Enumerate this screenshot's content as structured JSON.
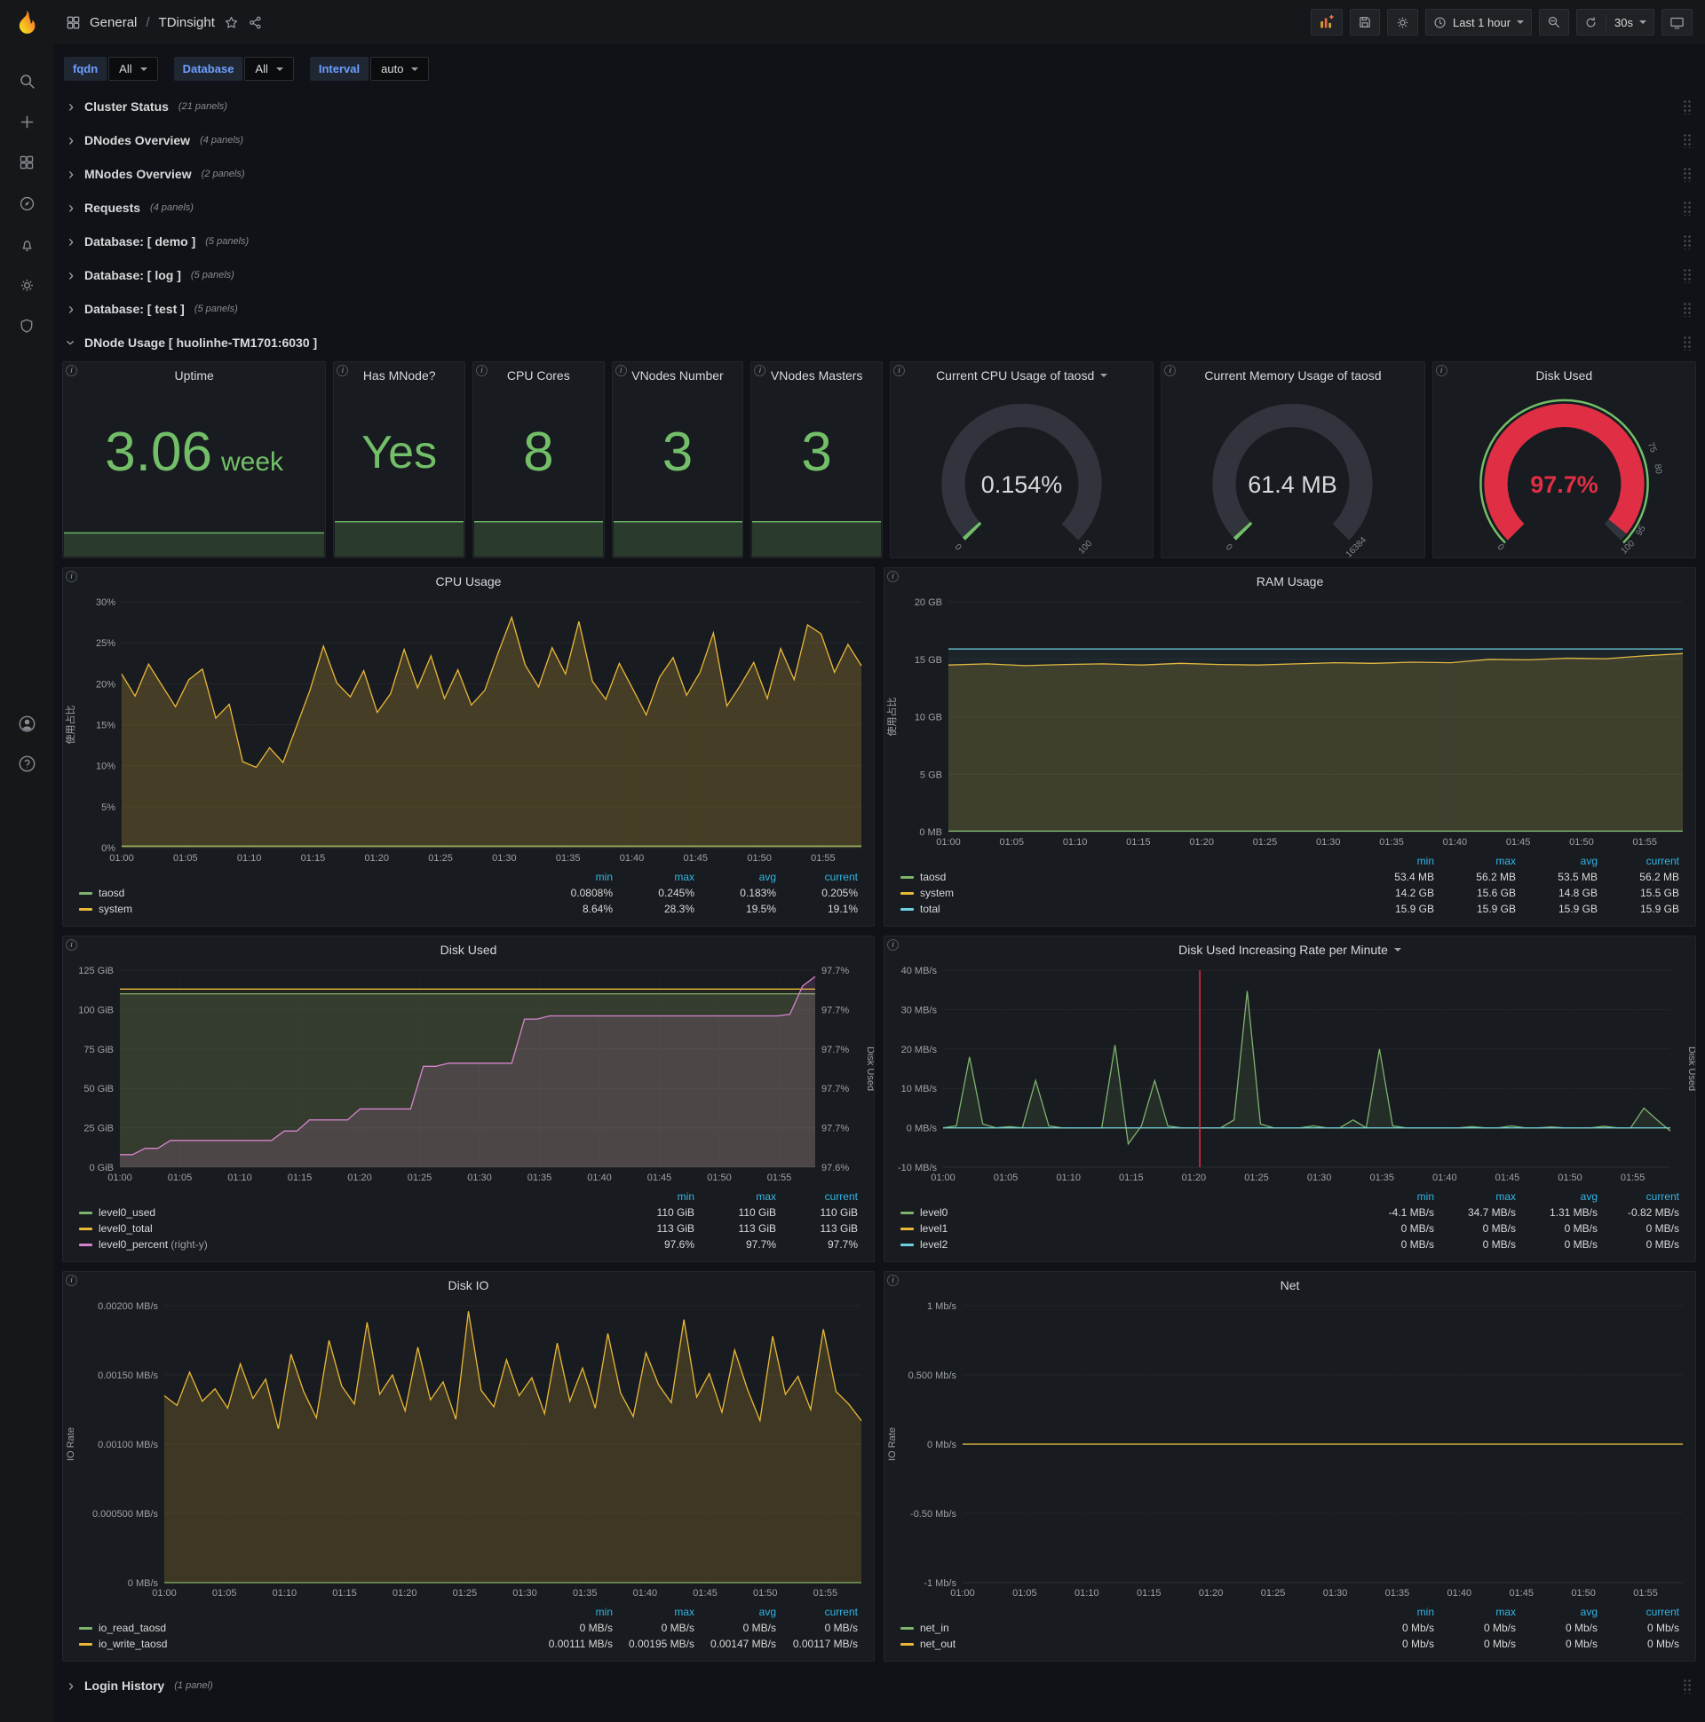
{
  "icons": {
    "info": "i",
    "chevron": "›",
    "star": "☆"
  },
  "nav": {
    "section": "General",
    "separator": "/",
    "page": "TDinsight",
    "time_range": "Last 1 hour",
    "refresh": "30s"
  },
  "variables": {
    "fqdn": {
      "label": "fqdn",
      "value": "All"
    },
    "database": {
      "label": "Database",
      "value": "All"
    },
    "interval": {
      "label": "Interval",
      "value": "auto"
    }
  },
  "rows": [
    {
      "title": "Cluster Status",
      "count": "(21 panels)"
    },
    {
      "title": "DNodes Overview",
      "count": "(4 panels)"
    },
    {
      "title": "MNodes Overview",
      "count": "(2 panels)"
    },
    {
      "title": "Requests",
      "count": "(4 panels)"
    },
    {
      "title": "Database: [ demo ]",
      "count": "(5 panels)"
    },
    {
      "title": "Database: [ log ]",
      "count": "(5 panels)"
    },
    {
      "title": "Database: [ test ]",
      "count": "(5 panels)"
    }
  ],
  "dnode_row": {
    "title": "DNode Usage [ huolinhe-TM1701:6030 ]"
  },
  "login_row": {
    "title": "Login History",
    "count": "(1 panel)"
  },
  "stats": {
    "uptime": {
      "title": "Uptime",
      "value": "3.06",
      "unit": "week"
    },
    "has_mnode": {
      "title": "Has MNode?",
      "value": "Yes"
    },
    "cpu_cores": {
      "title": "CPU Cores",
      "value": "8"
    },
    "vnodes_number": {
      "title": "VNodes Number",
      "value": "3"
    },
    "vnodes_masters": {
      "title": "VNodes Masters",
      "value": "3"
    }
  },
  "gauges": {
    "cpu": {
      "title": "Current CPU Usage of taosd",
      "value_text": "0.154%",
      "value_color": "#d8d9da",
      "color": "#73BF69",
      "fraction": 0.00154,
      "min_label": "0",
      "max_label": "100"
    },
    "mem": {
      "title": "Current Memory Usage of taosd",
      "value_text": "61.4 MB",
      "value_color": "#d8d9da",
      "color": "#73BF69",
      "fraction": 0.0037,
      "min_label": "0",
      "max_label": "16384"
    },
    "disk": {
      "title": "Disk Used",
      "value_text": "97.7%",
      "value_color": "#E02F44",
      "color": "#E02F44",
      "fraction": 0.977,
      "min_label": "0",
      "ring": "#73BF69",
      "ticks": [
        {
          "f": 0.75,
          "label": "75"
        },
        {
          "f": 0.8,
          "label": "80"
        },
        {
          "f": 0.95,
          "label": "95"
        },
        {
          "f": 1,
          "label": "100"
        }
      ]
    }
  },
  "shared": {
    "x_labels": [
      "01:00",
      "01:05",
      "01:10",
      "01:15",
      "01:20",
      "01:25",
      "01:30",
      "01:35",
      "01:40",
      "01:45",
      "01:50",
      "01:55"
    ]
  },
  "charts": {
    "cpu_usage": {
      "type": "line",
      "title": "CPU Usage",
      "y_label": "使用占比",
      "pad_l": 52,
      "y_min": 0,
      "y_max": 30,
      "y_ticks": [
        "0%",
        "5%",
        "10%",
        "15%",
        "20%",
        "25%",
        "30%"
      ],
      "series": [
        {
          "name": "taosd",
          "color": "#7EB26D",
          "fill": 0.1,
          "values": [
            0.2,
            0.2
          ]
        },
        {
          "name": "system",
          "color": "#EAB839",
          "fill": 0.22,
          "values": [
            21.2,
            18.5,
            22.4,
            19.8,
            17.2,
            20.5,
            21.8,
            15.8,
            17.5,
            10.5,
            9.8,
            12.2,
            10.4,
            14.8,
            19.2,
            24.6,
            20.1,
            18.4,
            21.6,
            16.5,
            18.8,
            24.2,
            19.5,
            23.4,
            18.2,
            21.7,
            17.4,
            19.2,
            23.8,
            28.1,
            22.3,
            19.6,
            24.4,
            21.2,
            27.6,
            20.3,
            18.1,
            22.5,
            19.4,
            16.2,
            20.8,
            23.2,
            18.6,
            21.4,
            26.2,
            17.3,
            19.8,
            22.6,
            18.2,
            24.3,
            20.5,
            27.2,
            26.1,
            21.4,
            24.8,
            22.2
          ]
        }
      ],
      "legend": {
        "columns": [
          "min",
          "max",
          "avg",
          "current"
        ],
        "rows": [
          {
            "name": "taosd",
            "color": "#7EB26D",
            "values": [
              "0.0808%",
              "0.245%",
              "0.183%",
              "0.205%"
            ]
          },
          {
            "name": "system",
            "color": "#EAB839",
            "values": [
              "8.64%",
              "28.3%",
              "19.5%",
              "19.1%"
            ]
          }
        ]
      }
    },
    "ram_usage": {
      "type": "line",
      "title": "RAM Usage",
      "y_label": "使用占比",
      "pad_l": 58,
      "y_min": 0,
      "y_max": 20,
      "y_ticks": [
        "0 MB",
        "5 GB",
        "10 GB",
        "15 GB",
        "20 GB"
      ],
      "series": [
        {
          "name": "system",
          "color": "#EAB839",
          "fill": 0.18,
          "values": [
            14.5,
            14.6,
            14.45,
            14.55,
            14.6,
            14.5,
            14.65,
            14.55,
            14.5,
            14.6,
            14.7,
            14.65,
            14.75,
            14.7,
            15.0,
            14.95,
            15.1,
            15.05,
            15.3,
            15.5
          ]
        },
        {
          "name": "total",
          "color": "#6ED0E0",
          "fill": 0.06,
          "values": [
            15.9,
            15.9
          ]
        },
        {
          "name": "taosd",
          "color": "#7EB26D",
          "fill": 0.1,
          "values": [
            0.055,
            0.055
          ]
        }
      ],
      "legend": {
        "columns": [
          "min",
          "max",
          "avg",
          "current"
        ],
        "rows": [
          {
            "name": "taosd",
            "color": "#7EB26D",
            "values": [
              "53.4 MB",
              "56.2 MB",
              "53.5 MB",
              "56.2 MB"
            ]
          },
          {
            "name": "system",
            "color": "#EAB839",
            "values": [
              "14.2 GB",
              "15.6 GB",
              "14.8 GB",
              "15.5 GB"
            ]
          },
          {
            "name": "total",
            "color": "#6ED0E0",
            "values": [
              "15.9 GB",
              "15.9 GB",
              "15.9 GB",
              "15.9 GB"
            ]
          }
        ]
      }
    },
    "disk_used": {
      "type": "line",
      "title": "Disk Used",
      "pad_l": 64,
      "pad_r": 52,
      "y2_label": "Disk Used",
      "y_min": 0,
      "y_max": 125,
      "y_ticks": [
        "0 GiB",
        "25 GiB",
        "50 GiB",
        "75 GiB",
        "100 GiB",
        "125 GiB"
      ],
      "y2_min": 97.595,
      "y2_max": 97.72,
      "y2_ticks": [
        "97.6%",
        "97.7%",
        "97.7%",
        "97.7%",
        "97.7%",
        "97.7%"
      ],
      "series": [
        {
          "name": "level0_used",
          "color": "#7EB26D",
          "fill": 0.18,
          "values": [
            110,
            110
          ]
        },
        {
          "name": "level0_total",
          "color": "#EAB839",
          "fill": 0.05,
          "values": [
            113,
            113
          ]
        },
        {
          "name": "level0_percent",
          "color": "#D683CE",
          "fill": 0.16,
          "axis": "y2",
          "values": [
            97.603,
            97.603,
            97.607,
            97.607,
            97.612,
            97.612,
            97.612,
            97.612,
            97.612,
            97.612,
            97.612,
            97.612,
            97.612,
            97.618,
            97.618,
            97.625,
            97.625,
            97.625,
            97.625,
            97.632,
            97.632,
            97.632,
            97.632,
            97.632,
            97.659,
            97.659,
            97.661,
            97.661,
            97.661,
            97.661,
            97.661,
            97.661,
            97.689,
            97.689,
            97.691,
            97.691,
            97.691,
            97.691,
            97.691,
            97.691,
            97.691,
            97.691,
            97.691,
            97.691,
            97.691,
            97.691,
            97.691,
            97.691,
            97.691,
            97.691,
            97.691,
            97.691,
            97.691,
            97.692,
            97.71,
            97.716
          ]
        }
      ],
      "legend": {
        "columns": [
          "min",
          "max",
          "current"
        ],
        "rows": [
          {
            "name": "level0_used",
            "color": "#7EB26D",
            "values": [
              "110 GiB",
              "110 GiB",
              "110 GiB"
            ]
          },
          {
            "name": "level0_total",
            "color": "#EAB839",
            "values": [
              "113 GiB",
              "113 GiB",
              "113 GiB"
            ]
          },
          {
            "name": "level0_percent",
            "color": "#D683CE",
            "suffix": "(right-y)",
            "values": [
              "97.6%",
              "97.7%",
              "97.7%"
            ]
          }
        ]
      }
    },
    "disk_rate": {
      "type": "line",
      "title": "Disk Used Increasing Rate per Minute",
      "pad_l": 66,
      "y2_label": "Disk Used",
      "annotation_x": 0.353,
      "y_min": -10,
      "y_max": 40,
      "y_ticks": [
        "-10 MB/s",
        "0 MB/s",
        "10 MB/s",
        "20 MB/s",
        "30 MB/s",
        "40 MB/s"
      ],
      "series": [
        {
          "name": "level0",
          "color": "#7EB26D",
          "fill": 0.12,
          "values": [
            0,
            0.5,
            18,
            1,
            0,
            0.3,
            0,
            12,
            0.5,
            0,
            0,
            0,
            0,
            21,
            -4.1,
            0.5,
            12,
            0.5,
            0,
            0,
            0,
            0,
            2,
            34.7,
            1,
            0,
            0,
            0,
            0.5,
            0,
            0,
            2,
            0,
            20,
            0.5,
            0,
            0,
            0,
            0,
            0,
            0.3,
            0,
            0,
            0.5,
            0,
            0,
            0.2,
            0,
            0,
            0,
            0.4,
            0,
            0,
            5,
            2,
            -0.82
          ]
        },
        {
          "name": "level1",
          "color": "#EAB839",
          "values": [
            0,
            0
          ]
        },
        {
          "name": "level2",
          "color": "#6ED0E0",
          "values": [
            0,
            0
          ]
        }
      ],
      "legend": {
        "columns": [
          "min",
          "max",
          "avg",
          "current"
        ],
        "rows": [
          {
            "name": "level0",
            "color": "#7EB26D",
            "values": [
              "-4.1 MB/s",
              "34.7 MB/s",
              "1.31 MB/s",
              "-0.82 MB/s"
            ]
          },
          {
            "name": "level1",
            "color": "#EAB839",
            "values": [
              "0 MB/s",
              "0 MB/s",
              "0 MB/s",
              "0 MB/s"
            ]
          },
          {
            "name": "level2",
            "color": "#6ED0E0",
            "values": [
              "0 MB/s",
              "0 MB/s",
              "0 MB/s",
              "0 MB/s"
            ]
          }
        ]
      }
    },
    "disk_io": {
      "type": "line",
      "title": "Disk IO",
      "y_label": "IO Rate",
      "pad_l": 100,
      "y_min": 0,
      "y_max": 0.002,
      "y_ticks": [
        "0 MB/s",
        "0.000500 MB/s",
        "0.00100 MB/s",
        "0.00150 MB/s",
        "0.00200 MB/s"
      ],
      "series": [
        {
          "name": "io_read_taosd",
          "color": "#7EB26D",
          "values": [
            0,
            0
          ]
        },
        {
          "name": "io_write_taosd",
          "color": "#EAB839",
          "fill": 0.18,
          "values": [
            0.00135,
            0.00128,
            0.00152,
            0.00131,
            0.0014,
            0.00126,
            0.00158,
            0.00133,
            0.00147,
            0.00111,
            0.00165,
            0.00138,
            0.00119,
            0.00175,
            0.00142,
            0.00129,
            0.00188,
            0.00136,
            0.0015,
            0.00124,
            0.0017,
            0.00132,
            0.00145,
            0.00118,
            0.00196,
            0.00139,
            0.00127,
            0.00161,
            0.00135,
            0.00148,
            0.00122,
            0.00173,
            0.00131,
            0.00155,
            0.00126,
            0.0018,
            0.00137,
            0.0012,
            0.00166,
            0.00143,
            0.0013,
            0.0019,
            0.00134,
            0.00151,
            0.00123,
            0.00168,
            0.0014,
            0.00117,
            0.00178,
            0.00136,
            0.00149,
            0.00125,
            0.00183,
            0.00138,
            0.00129,
            0.00117
          ]
        }
      ],
      "legend": {
        "columns": [
          "min",
          "max",
          "avg",
          "current"
        ],
        "rows": [
          {
            "name": "io_read_taosd",
            "color": "#7EB26D",
            "values": [
              "0 MB/s",
              "0 MB/s",
              "0 MB/s",
              "0 MB/s"
            ]
          },
          {
            "name": "io_write_taosd",
            "color": "#EAB839",
            "values": [
              "0.00111 MB/s",
              "0.00195 MB/s",
              "0.00147 MB/s",
              "0.00117 MB/s"
            ]
          }
        ]
      }
    },
    "net": {
      "type": "line",
      "title": "Net",
      "y_label": "IO Rate",
      "pad_l": 74,
      "y_min": -1,
      "y_max": 1,
      "y_ticks": [
        "-1 Mb/s",
        "-0.50 Mb/s",
        "0 Mb/s",
        "0.500 Mb/s",
        "1 Mb/s"
      ],
      "series": [
        {
          "name": "net_in",
          "color": "#7EB26D",
          "values": [
            0,
            0
          ]
        },
        {
          "name": "net_out",
          "color": "#EAB839",
          "values": [
            0,
            0
          ]
        }
      ],
      "legend": {
        "columns": [
          "min",
          "max",
          "avg",
          "current"
        ],
        "rows": [
          {
            "name": "net_in",
            "color": "#7EB26D",
            "values": [
              "0 Mb/s",
              "0 Mb/s",
              "0 Mb/s",
              "0 Mb/s"
            ]
          },
          {
            "name": "net_out",
            "color": "#EAB839",
            "values": [
              "0 Mb/s",
              "0 Mb/s",
              "0 Mb/s",
              "0 Mb/s"
            ]
          }
        ]
      }
    }
  }
}
